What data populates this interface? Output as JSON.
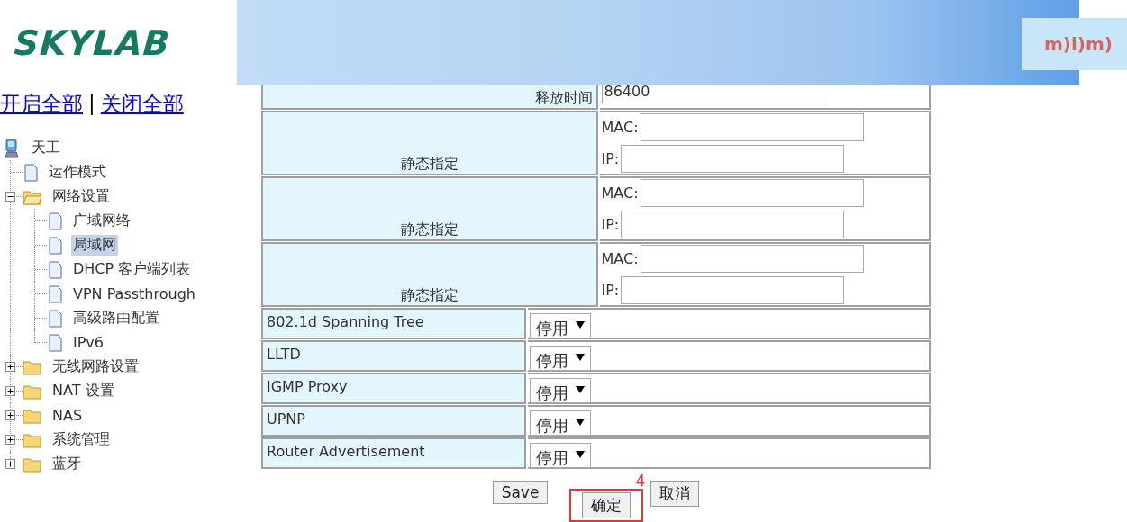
{
  "logo": {
    "text": "SKYLAB"
  },
  "links": [
    {
      "label": "开启全部"
    },
    {
      "label": "关闭全部"
    }
  ],
  "link_separator": "|",
  "tree": {
    "label": "天工",
    "kind": "computer",
    "children": [
      {
        "label": "运作模式",
        "kind": "page",
        "selected": false
      },
      {
        "label": "网络设置",
        "kind": "folder",
        "expanded": true,
        "children": [
          {
            "label": "广域网络",
            "kind": "page",
            "selected": false
          },
          {
            "label": "局域网",
            "kind": "page",
            "selected": true
          },
          {
            "label": "DHCP 客户端列表",
            "kind": "page",
            "selected": false
          },
          {
            "label": "VPN Passthrough",
            "kind": "page",
            "selected": false
          },
          {
            "label": "高级路由配置",
            "kind": "page",
            "selected": false
          },
          {
            "label": "IPv6",
            "kind": "page",
            "selected": false
          }
        ]
      },
      {
        "label": "无线网路设置",
        "kind": "folder",
        "expanded": false
      },
      {
        "label": "NAT 设置",
        "kind": "folder",
        "expanded": false
      },
      {
        "label": "NAS",
        "kind": "folder",
        "expanded": false
      },
      {
        "label": "系统管理",
        "kind": "folder",
        "expanded": false
      },
      {
        "label": "蓝牙",
        "kind": "folder",
        "expanded": false
      }
    ]
  },
  "banner": {
    "logo_text": "m)i)m)"
  },
  "form": {
    "rows": [
      {
        "kind": "text",
        "label": "释放时间",
        "value": "86400"
      },
      {
        "kind": "static",
        "label": "静态指定",
        "fields": [
          {
            "label": "MAC:"
          },
          {
            "label": "IP:"
          }
        ]
      },
      {
        "kind": "static",
        "label": "静态指定",
        "fields": [
          {
            "label": "MAC:"
          },
          {
            "label": "IP:"
          }
        ]
      },
      {
        "kind": "static",
        "label": "静态指定",
        "fields": [
          {
            "label": "MAC:"
          },
          {
            "label": "IP:"
          }
        ]
      },
      {
        "kind": "select",
        "label": "802.1d Spanning Tree",
        "value": "停用"
      },
      {
        "kind": "select",
        "label": "LLTD",
        "value": "停用"
      },
      {
        "kind": "select",
        "label": "IGMP Proxy",
        "value": "停用"
      },
      {
        "kind": "select",
        "label": "UPNP",
        "value": "停用"
      },
      {
        "kind": "select",
        "label": "Router Advertisement",
        "value": "停用"
      }
    ]
  },
  "buttons": [
    {
      "label": "Save",
      "highlighted": false
    },
    {
      "label": "确定",
      "highlighted": true
    },
    {
      "label": "取消",
      "highlighted": false
    }
  ],
  "annotation": {
    "label": "4"
  }
}
